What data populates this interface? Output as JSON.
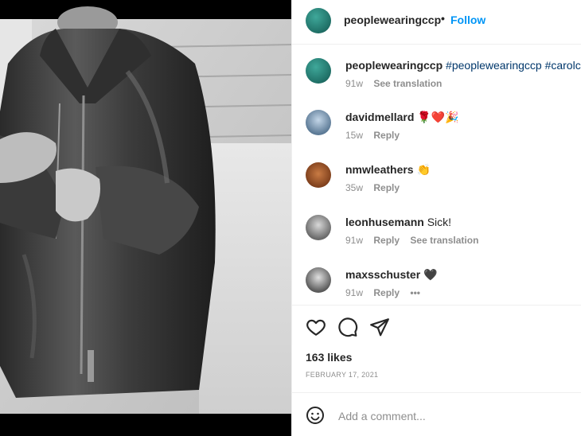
{
  "post": {
    "author": "peoplewearingccp",
    "follow_label": "Follow",
    "separator": "•",
    "caption": {
      "username": "peoplewearingccp",
      "text": "#peoplewearingccp #carolch",
      "age": "91w",
      "translate": "See translation"
    },
    "comments": [
      {
        "username": "davidmellard",
        "text": "🌹❤️🎉",
        "age": "15w",
        "reply": "Reply"
      },
      {
        "username": "nmwleathers",
        "text": "👏",
        "age": "35w",
        "reply": "Reply"
      },
      {
        "username": "leonhusemann",
        "text": "Sick!",
        "age": "91w",
        "reply": "Reply",
        "translate": "See translation"
      },
      {
        "username": "maxsschuster",
        "text": "🖤",
        "age": "91w",
        "reply": "Reply",
        "more": "•••"
      }
    ],
    "likes": "163 likes",
    "date": "FEBRUARY 17, 2021",
    "add_comment_placeholder": "Add a comment..."
  },
  "colors": {
    "link_blue": "#0095f6",
    "hashtag": "#00376b",
    "muted": "#8e8e8e",
    "text": "#262626"
  },
  "icons": [
    "heart-icon",
    "comment-icon",
    "share-icon",
    "emoji-icon"
  ]
}
